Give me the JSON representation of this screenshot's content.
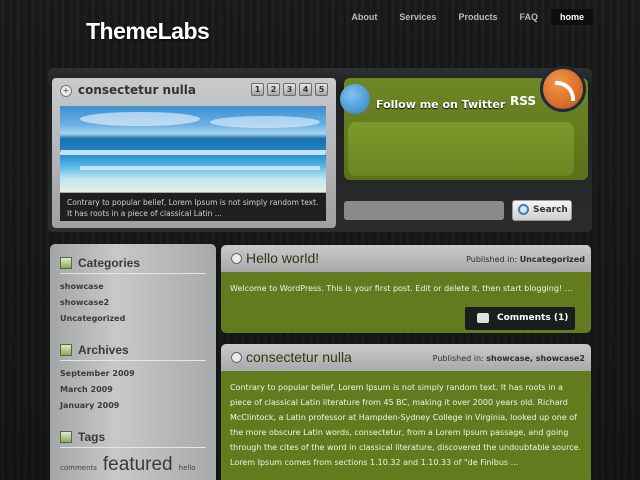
{
  "site": {
    "logo": "ThemeLabs"
  },
  "nav": [
    {
      "label": "About"
    },
    {
      "label": "Services"
    },
    {
      "label": "Products"
    },
    {
      "label": "FAQ"
    },
    {
      "label": "home",
      "active": true
    }
  ],
  "featured": {
    "title": "consectetur nulla",
    "pages": [
      "1",
      "2",
      "3",
      "4",
      "5"
    ],
    "caption": "Contrary to popular belief, Lorem Ipsum is not simply random text. It has roots in a piece of classical Latin ..."
  },
  "social": {
    "twitter_label": "Follow me on Twitter",
    "rss_label": "RSS"
  },
  "search": {
    "placeholder": "",
    "button_label": "Search"
  },
  "sidebar": {
    "categories": {
      "title": "Categories",
      "items": [
        "showcase",
        "showcase2",
        "Uncategorized"
      ]
    },
    "archives": {
      "title": "Archives",
      "items": [
        "September 2009",
        "March 2009",
        "January 2009"
      ]
    },
    "tags": {
      "title": "Tags",
      "items": [
        "comments",
        "featured",
        "hello"
      ]
    }
  },
  "posts": [
    {
      "title": "Hello world!",
      "meta_prefix": "Published in:",
      "categories": "Uncategorized",
      "body": "Welcome to WordPress. This is your first post. Edit or delete it, then start blogging! ...",
      "comments": "Comments (1)"
    },
    {
      "title": "consectetur nulla",
      "meta_prefix": "Published in:",
      "categories": "showcase, showcase2",
      "body": "Contrary to popular belief, Lorem Ipsum is not simply random text. It has roots in a piece of classical Latin literature from 45 BC, making it over 2000 years old. Richard McClintock, a Latin professor at Hampden-Sydney College in Virginia, looked up one of the more obscure Latin words, consectetur, from a Lorem Ipsum passage, and going through the cites of the word in classical literature, discovered the undoubtable source. Lorem Ipsum comes from sections 1.10.32 and 1.10.33 of \"de Finibus ..."
    }
  ],
  "colors": {
    "accent_green": "#637b1f",
    "panel_grey": "#b5b6b7"
  }
}
